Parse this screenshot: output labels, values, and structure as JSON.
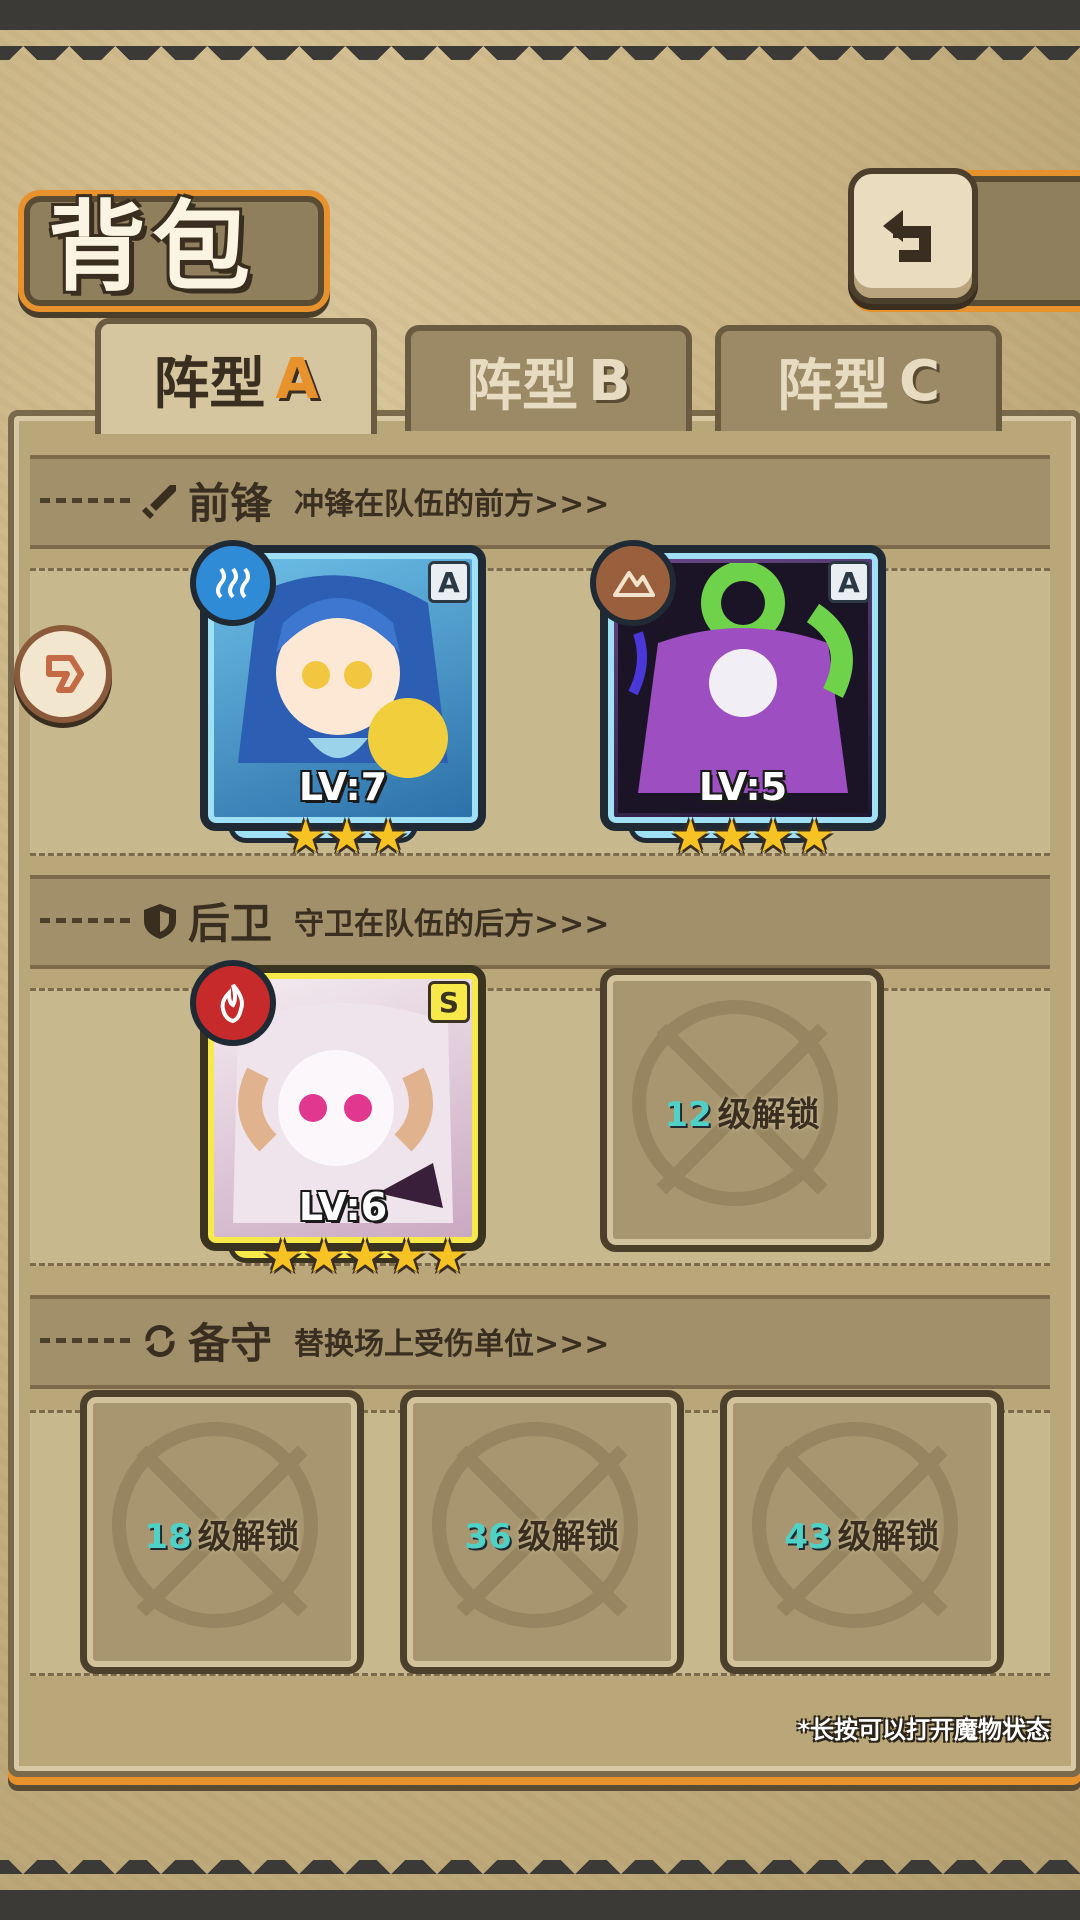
{
  "header": {
    "title": "背包"
  },
  "tabs": [
    {
      "label": "阵型",
      "suffix": "A",
      "active": true
    },
    {
      "label": "阵型",
      "suffix": "B",
      "active": false
    },
    {
      "label": "阵型",
      "suffix": "C",
      "active": false
    }
  ],
  "sections": {
    "front": {
      "title": "前锋",
      "subtitle": "冲锋在队伍的前方>>>"
    },
    "rear": {
      "title": "后卫",
      "subtitle": "守卫在队伍的后方>>>"
    },
    "reserve": {
      "title": "备守",
      "subtitle": "替换场上受伤单位>>>"
    }
  },
  "heroes": {
    "front_1": {
      "level": "LV:7",
      "grade": "A",
      "stars": 3,
      "element_icon": "water-icon"
    },
    "front_2": {
      "level": "LV:5",
      "grade": "A",
      "stars": 4,
      "element_icon": "earth-icon"
    },
    "rear_1": {
      "level": "LV:6",
      "grade": "S",
      "stars": 5,
      "element_icon": "fire-icon"
    }
  },
  "locked_slots": {
    "rear_2": {
      "level": "12",
      "text": "级解锁"
    },
    "reserve_1": {
      "level": "18",
      "text": "级解锁"
    },
    "reserve_2": {
      "level": "36",
      "text": "级解锁"
    },
    "reserve_3": {
      "level": "43",
      "text": "级解锁"
    }
  },
  "hint": "*长按可以打开魔物状态",
  "colors": {
    "accent": "#e8922e",
    "unlock_number": "#4fd1c5",
    "star": "#f7c324"
  }
}
